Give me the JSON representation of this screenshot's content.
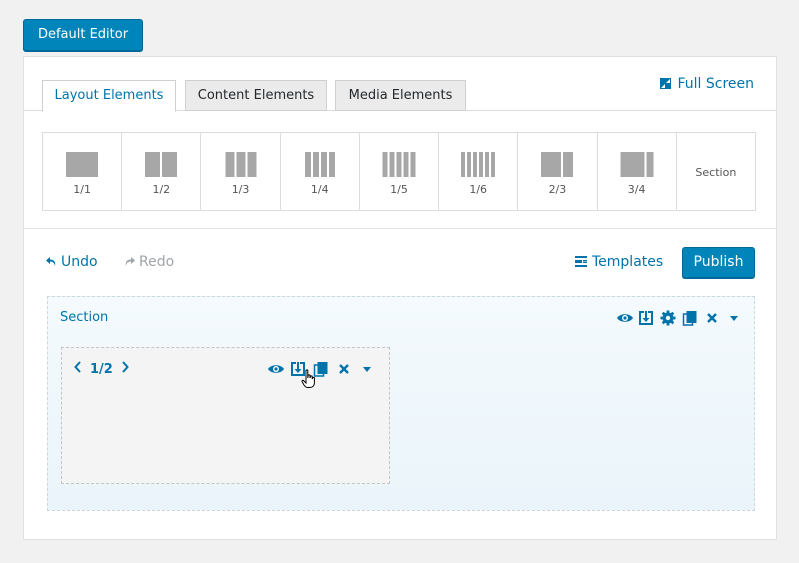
{
  "top_button": "Default Editor",
  "tabs": [
    "Layout Elements",
    "Content Elements",
    "Media Elements"
  ],
  "active_tab": "Layout Elements",
  "full_screen": "Full Screen",
  "layouts": [
    {
      "label": "1/1"
    },
    {
      "label": "1/2"
    },
    {
      "label": "1/3"
    },
    {
      "label": "1/4"
    },
    {
      "label": "1/5"
    },
    {
      "label": "1/6"
    },
    {
      "label": "2/3"
    },
    {
      "label": "3/4"
    },
    {
      "label": "Section"
    }
  ],
  "toolbar": {
    "undo": "Undo",
    "redo": "Redo",
    "templates": "Templates",
    "publish": "Publish"
  },
  "section": {
    "title": "Section"
  },
  "column": {
    "label": "1/2"
  },
  "colors": {
    "accent": "#0073aa",
    "button": "#0085ba",
    "disabled": "#a0a5aa"
  }
}
